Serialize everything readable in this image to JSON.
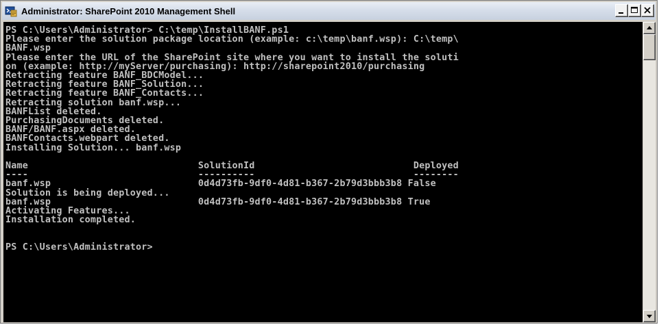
{
  "window": {
    "title": "Administrator: SharePoint 2010 Management Shell",
    "icon": "powershell-icon",
    "title_color": "#000000"
  },
  "controls": {
    "minimize_icon": "minimize-icon",
    "maximize_icon": "maximize-icon",
    "close_icon": "close-icon"
  },
  "console": {
    "background": "#000000",
    "foreground": "#c0c0c0",
    "lines": [
      "PS C:\\Users\\Administrator> C:\\temp\\InstallBANF.ps1",
      "Please enter the solution package location (example: c:\\temp\\banf.wsp): C:\\temp\\",
      "BANF.wsp",
      "Please enter the URL of the SharePoint site where you want to install the soluti",
      "on (example: http://myServer/purchasing): http://sharepoint2010/purchasing",
      "Retracting feature BANF_BDCModel...",
      "Retracting feature BANF_Solution...",
      "Retracting feature BANF_Contacts...",
      "Retracting solution banf.wsp...",
      "BANFList deleted.",
      "PurchasingDocuments deleted.",
      "BANF/BANF.aspx deleted.",
      "BANFContacts.webpart deleted.",
      "Installing Solution... banf.wsp",
      "",
      "Name                              SolutionId                            Deployed",
      "----                              ----------                            --------",
      "banf.wsp                          0d4d73fb-9df0-4d81-b367-2b79d3bbb3b8 False",
      "Solution is being deployed...",
      "banf.wsp                          0d4d73fb-9df0-4d81-b367-2b79d3bbb3b8 True",
      "Activating Features...",
      "Installation completed.",
      "",
      "",
      "PS C:\\Users\\Administrator>"
    ]
  },
  "scrollbar": {
    "up_icon": "scroll-up-arrow-icon",
    "down_icon": "scroll-down-arrow-icon"
  }
}
